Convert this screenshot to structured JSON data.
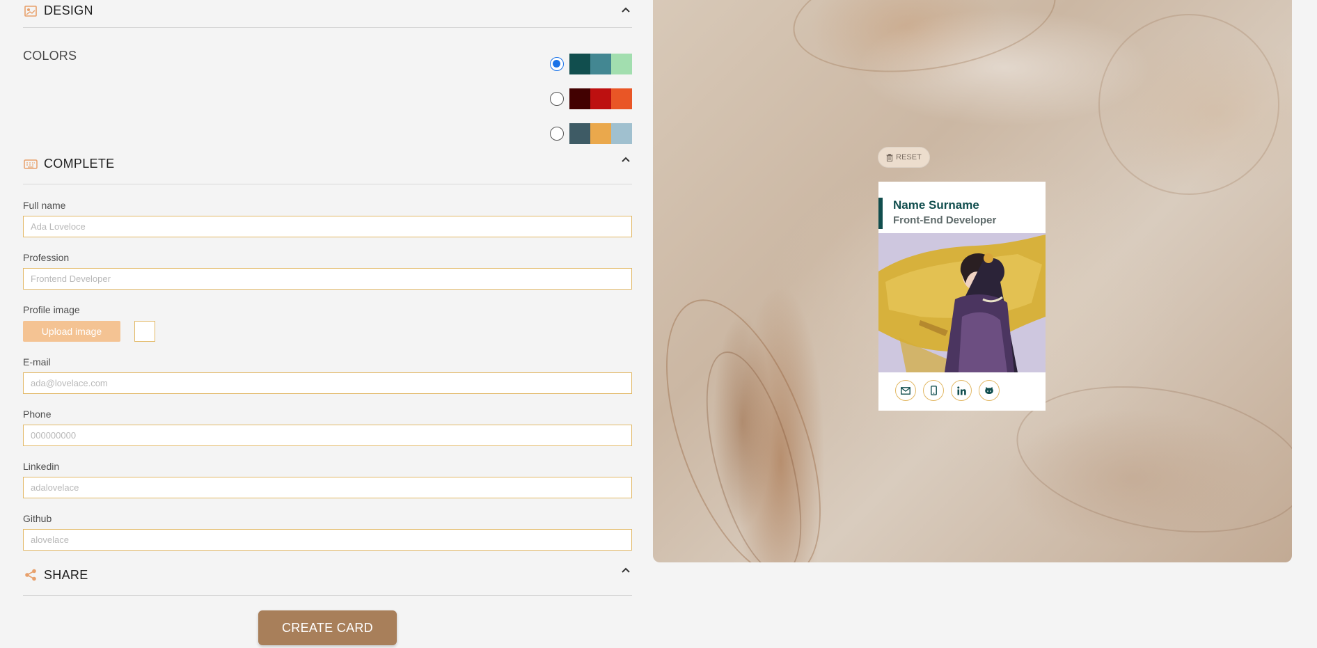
{
  "design": {
    "title": "DESIGN",
    "colors_label": "COLORS",
    "palettes": [
      {
        "selected": true,
        "colors": [
          "#114e4e",
          "#438792",
          "#a2deaf"
        ]
      },
      {
        "selected": false,
        "colors": [
          "#420101",
          "#bd1010",
          "#e95626"
        ]
      },
      {
        "selected": false,
        "colors": [
          "#3e5b65",
          "#eaa84c",
          "#a0c0cf"
        ]
      }
    ]
  },
  "complete": {
    "title": "COMPLETE",
    "fields": {
      "fullname": {
        "label": "Full name",
        "placeholder": "Ada Loveloce"
      },
      "profession": {
        "label": "Profession",
        "placeholder": "Frontend Developer"
      },
      "image": {
        "label": "Profile image",
        "button": "Upload image"
      },
      "email": {
        "label": "E-mail",
        "placeholder": "ada@lovelace.com"
      },
      "phone": {
        "label": "Phone",
        "placeholder": "000000000"
      },
      "linkedin": {
        "label": "Linkedin",
        "placeholder": "adalovelace"
      },
      "github": {
        "label": "Github",
        "placeholder": "alovelace"
      }
    }
  },
  "share": {
    "title": "SHARE",
    "create_button": "CREATE CARD"
  },
  "preview": {
    "reset": "RESET",
    "card": {
      "name": "Name Surname",
      "job": "Front-End Developer",
      "socials": [
        "mail-icon",
        "mobile-phone-icon",
        "linkedin-icon",
        "github-icon"
      ]
    }
  },
  "accent": "#e2b865",
  "brand": "#a87f5a"
}
